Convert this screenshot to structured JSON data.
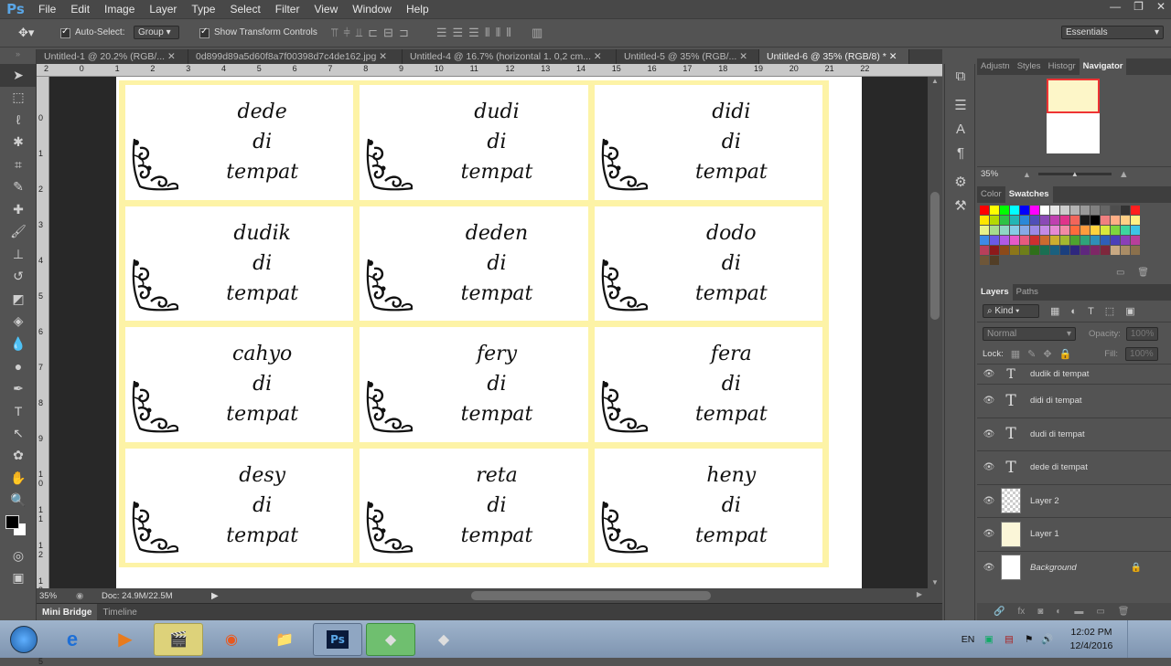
{
  "app": {
    "logo": "Ps",
    "menu": [
      "File",
      "Edit",
      "Image",
      "Layer",
      "Type",
      "Select",
      "Filter",
      "View",
      "Window",
      "Help"
    ],
    "window_controls": [
      "—",
      "❐",
      "✕"
    ]
  },
  "options": {
    "auto_select_label": "Auto-Select:",
    "auto_select_value": "Group",
    "show_transform_label": "Show Transform Controls",
    "workspace": "Essentials"
  },
  "tabs": [
    {
      "label": "Untitled-1 @ 20.2% (RGB/...",
      "active": false
    },
    {
      "label": "0d899d89a5d60f8a7f00398d7c4de162.jpg",
      "active": false
    },
    {
      "label": "Untitled-4 @ 16.7% (horizontal 1. 0,2 cm...",
      "active": false
    },
    {
      "label": "Untitled-5 @ 35% (RGB/...",
      "active": false
    },
    {
      "label": "Untitled-6 @ 35% (RGB/8) *",
      "active": true
    }
  ],
  "ruler_top": [
    "2",
    "0",
    "1",
    "2",
    "3",
    "4",
    "5",
    "6",
    "7",
    "8",
    "9",
    "10",
    "11",
    "12",
    "13",
    "14",
    "15",
    "16",
    "17",
    "18",
    "19",
    "20",
    "21",
    "22"
  ],
  "ruler_left": [
    "0",
    "1",
    "2",
    "3",
    "4",
    "5",
    "6",
    "7",
    "8",
    "9",
    "1 0",
    "1 1",
    "1 2",
    "1 3",
    "1 4",
    "1 5"
  ],
  "cards": [
    {
      "name": "dede",
      "l1": "di",
      "l2": "tempat"
    },
    {
      "name": "dudi",
      "l1": "di",
      "l2": "tempat"
    },
    {
      "name": "didi",
      "l1": "di",
      "l2": "tempat"
    },
    {
      "name": "dudik",
      "l1": "di",
      "l2": "tempat"
    },
    {
      "name": "deden",
      "l1": "di",
      "l2": "tempat"
    },
    {
      "name": "dodo",
      "l1": "di",
      "l2": "tempat"
    },
    {
      "name": "cahyo",
      "l1": "di",
      "l2": "tempat"
    },
    {
      "name": "fery",
      "l1": "di",
      "l2": "tempat"
    },
    {
      "name": "fera",
      "l1": "di",
      "l2": "tempat"
    },
    {
      "name": "desy",
      "l1": "di",
      "l2": "tempat"
    },
    {
      "name": "reta",
      "l1": "di",
      "l2": "tempat"
    },
    {
      "name": "heny",
      "l1": "di",
      "l2": "tempat"
    }
  ],
  "status": {
    "zoom": "35%",
    "doc": "Doc: 24.9M/22.5M"
  },
  "bottom_tabs": [
    "Mini Bridge",
    "Timeline"
  ],
  "panels": {
    "top_tabs": [
      "Adjustn",
      "Styles",
      "Histogr",
      "Navigator"
    ],
    "nav_zoom": "35%",
    "color_tabs": [
      "Color",
      "Swatches"
    ],
    "layers_tabs": [
      "Layers",
      "Paths"
    ],
    "kind_label": "Kind",
    "blend_mode": "Normal",
    "opacity_label": "Opacity:",
    "opacity_value": "100%",
    "lock_label": "Lock:",
    "fill_label": "Fill:",
    "fill_value": "100%",
    "layers": [
      {
        "name": "dudik di tempat",
        "type": "text"
      },
      {
        "name": "didi di tempat",
        "type": "text"
      },
      {
        "name": "dudi di tempat",
        "type": "text"
      },
      {
        "name": "dede di tempat",
        "type": "text"
      },
      {
        "name": "Layer 2",
        "type": "pixel"
      },
      {
        "name": "Layer 1",
        "type": "pixel-yellow"
      },
      {
        "name": "Background",
        "type": "background"
      }
    ]
  },
  "taskbar": {
    "lang": "EN",
    "time": "12:02 PM",
    "date": "12/4/2016"
  },
  "swatch_colors": [
    "#ff0000",
    "#ffff00",
    "#00ff00",
    "#00ffff",
    "#0000ff",
    "#ff00ff",
    "#ffffff",
    "#e6e6e6",
    "#cccccc",
    "#b3b3b3",
    "#999999",
    "#808080",
    "#666666",
    "#4d4d4d",
    "#333333",
    "#ff1f1f",
    "#ffe600",
    "#b5d900",
    "#2ec246",
    "#23b6b5",
    "#2a88d8",
    "#4f4fb8",
    "#8b49b6",
    "#c040b0",
    "#e0338a",
    "#f2655b",
    "#1a1a1a",
    "#000000",
    "#f08080",
    "#ffae86",
    "#ffcf86",
    "#fff086",
    "#e8f28a",
    "#a7dc8c",
    "#8fd6c4",
    "#86cce6",
    "#86a9e6",
    "#9c8ae6",
    "#c48ae6",
    "#e68ad4",
    "#f28aa4",
    "#ff6a3d",
    "#ff9b3d",
    "#ffd23d",
    "#d7e83d",
    "#7fd53d",
    "#3dd59f",
    "#3dc4e6",
    "#3d8be6",
    "#6a5ae6",
    "#b05ae6",
    "#e65ac9",
    "#e65a7e",
    "#cc2f2f",
    "#cc6a2f",
    "#ccad2f",
    "#a4b82f",
    "#4ea32f",
    "#2fa37a",
    "#2f8fb8",
    "#2f5fb8",
    "#4a3fb8",
    "#8a3fb8",
    "#b83f9a",
    "#b83f5a",
    "#8c1a1a",
    "#8c4a1a",
    "#8c761a",
    "#6e7e1a",
    "#2f6f1a",
    "#1a6f52",
    "#1a607e",
    "#1a3f7e",
    "#2e277e",
    "#5e277e",
    "#7e2766",
    "#7e273c",
    "#c8a882",
    "#a98c66",
    "#8a704c",
    "#6e5638",
    "#523e26"
  ]
}
